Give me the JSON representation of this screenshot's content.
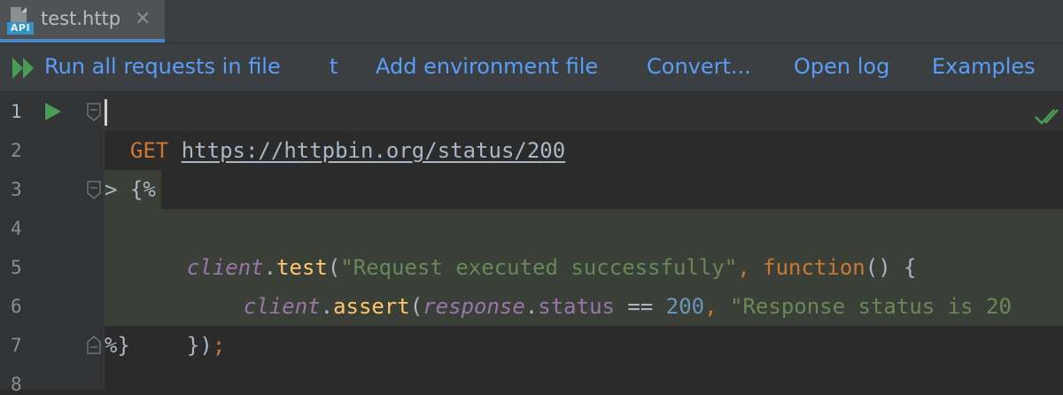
{
  "tab": {
    "icon_label": "API",
    "title": "test.http",
    "close_glyph": "✕"
  },
  "toolbar": {
    "run_all": "Run all requests in file",
    "t": "t",
    "add_env": "Add environment file",
    "convert": "Convert...",
    "open_log": "Open log",
    "examples": "Examples"
  },
  "gutter": {
    "line_numbers": [
      "1",
      "2",
      "3",
      "4",
      "5",
      "6",
      "7",
      "8"
    ]
  },
  "code": {
    "line1": {
      "method": "GET",
      "url": "https://httpbin.org/status/200"
    },
    "line3": {
      "text": "> {%"
    },
    "line4": {
      "obj": "client",
      "dot1": ".",
      "fn": "test",
      "open": "(",
      "str": "\"Request executed successfully\"",
      "comma": ", ",
      "kw": "function",
      "rest": "() {"
    },
    "line5": {
      "obj": "client",
      "dot1": ".",
      "fn": "assert",
      "open": "(",
      "obj2": "response",
      "dot2": ".",
      "prop": "status",
      "op": " == ",
      "num": "200",
      "comma": ", ",
      "str": "\"Response status is 20"
    },
    "line6": {
      "close": "})",
      "semi": ";"
    },
    "line7": {
      "text": "%}"
    }
  },
  "colors": {
    "accent": "#589df6",
    "run_green": "#499c54",
    "injected_bg": "#3a4038"
  },
  "icons": {
    "run_all": "double-play-icon",
    "run": "play-icon",
    "fold": "fold-icon",
    "status": "check-icon"
  }
}
